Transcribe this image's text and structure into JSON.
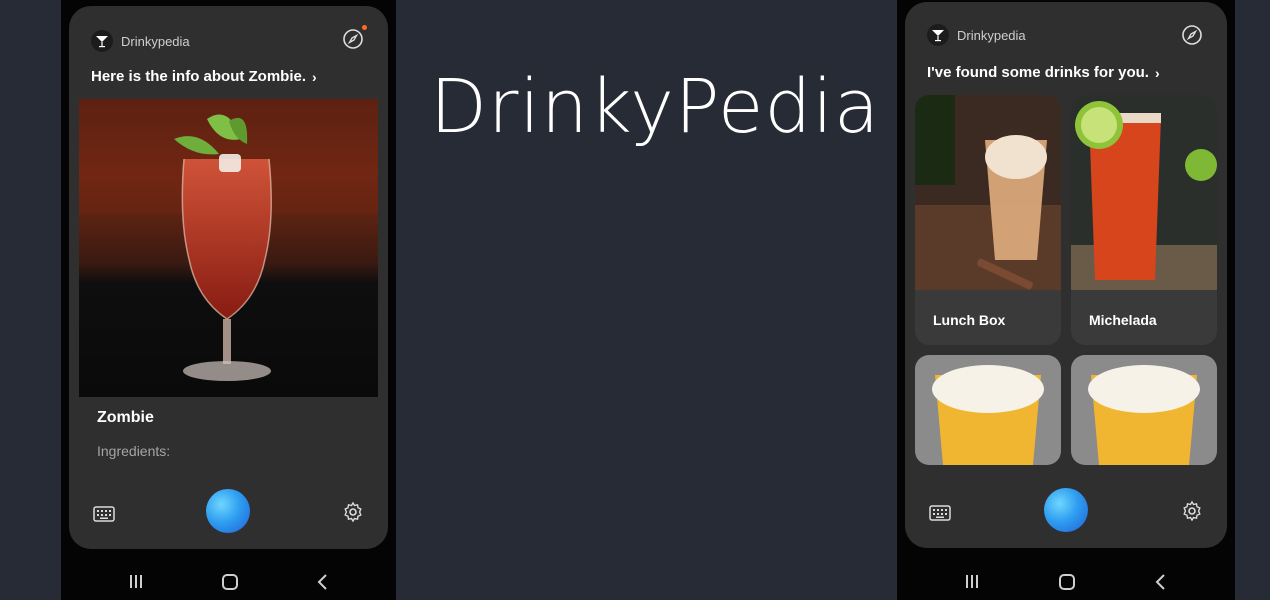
{
  "page_title": "DrinkyPedia",
  "left_phone": {
    "app_name": "Drinkypedia",
    "headline": "Here is the info about Zombie.",
    "drink": {
      "name": "Zombie",
      "ingredients_label": "Ingredients:"
    }
  },
  "right_phone": {
    "app_name": "Drinkypedia",
    "headline": "I've found some drinks for you.",
    "results": [
      {
        "name": "Lunch Box"
      },
      {
        "name": "Michelada"
      }
    ]
  },
  "icons": {
    "chevron": "›",
    "compass": "compass-icon",
    "keyboard": "keyboard-icon",
    "mic": "bixby-mic-icon",
    "settings": "gear-icon",
    "nav": [
      "recents-icon",
      "home-icon",
      "back-icon"
    ]
  },
  "colors": {
    "background": "#272b35",
    "card": "#2f2f2f",
    "accent_dot": "#ff6a2b",
    "mic": "#2f9ef0"
  }
}
